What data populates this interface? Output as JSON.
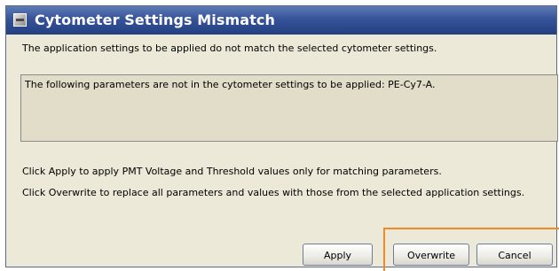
{
  "dialog": {
    "title": "Cytometer Settings Mismatch",
    "message_mismatch": "The application settings to be applied do not match the selected cytometer settings.",
    "parameters_text": "The following parameters are not in the cytometer settings to be applied: PE-Cy7-A.",
    "apply_info": "Click Apply to apply PMT Voltage and Threshold values only for matching parameters.",
    "overwrite_info": "Click Overwrite to replace all parameters and values with those from the selected application settings.",
    "buttons": {
      "apply": "Apply",
      "overwrite": "Overwrite",
      "cancel": "Cancel"
    }
  },
  "colors": {
    "titlebar": "#253f80",
    "highlight": "#f08a28",
    "dialog_bg": "#ece9d8"
  }
}
